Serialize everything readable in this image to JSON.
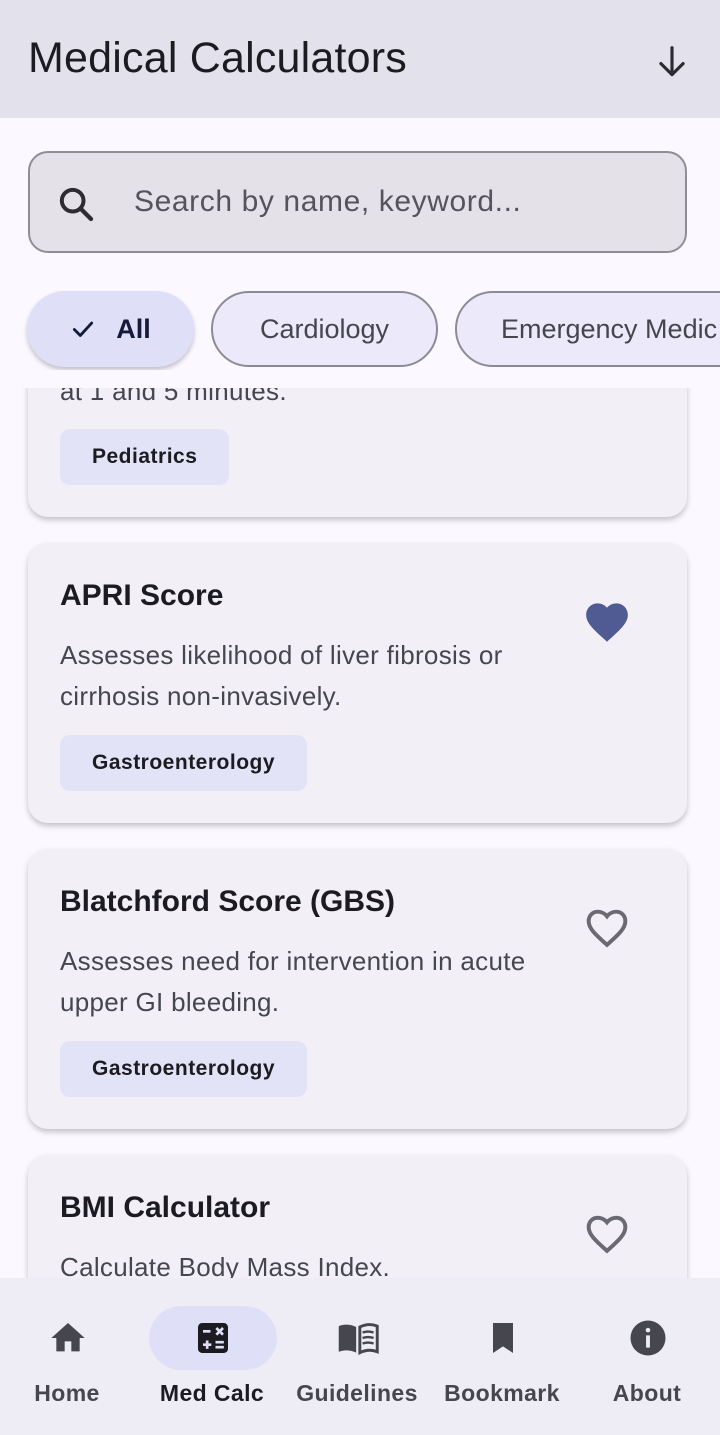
{
  "app_bar": {
    "title": "Medical Calculators",
    "action_icon": "arrow-down-icon"
  },
  "search": {
    "placeholder": "Search by name, keyword...",
    "icon": "search-icon"
  },
  "filters": [
    {
      "label": "All",
      "selected": true
    },
    {
      "label": "Cardiology",
      "selected": false
    },
    {
      "label": "Emergency Medic",
      "selected": false
    }
  ],
  "calculators": [
    {
      "title": "",
      "description": "at 1 and 5 minutes.",
      "tag": "Pediatrics",
      "favorite": null
    },
    {
      "title": "APRI Score",
      "description": "Assesses likelihood of liver fibrosis or cirrhosis non-invasively.",
      "tag": "Gastroenterology",
      "favorite": true
    },
    {
      "title": "Blatchford Score (GBS)",
      "description": "Assesses need for intervention in acute upper GI bleeding.",
      "tag": "Gastroenterology",
      "favorite": false
    },
    {
      "title": "BMI Calculator",
      "description": "Calculate Body Mass Index.",
      "tag": "",
      "favorite": false
    }
  ],
  "bottom_nav": [
    {
      "label": "Home",
      "icon": "home-icon",
      "active": false
    },
    {
      "label": "Med Calc",
      "icon": "calculator-icon",
      "active": true
    },
    {
      "label": "Guidelines",
      "icon": "book-icon",
      "active": false
    },
    {
      "label": "Bookmark",
      "icon": "bookmark-icon",
      "active": false
    },
    {
      "label": "About",
      "icon": "info-icon",
      "active": false
    }
  ],
  "colors": {
    "app_bar_bg": "#e3e1ec",
    "accent_indicator": "#dfe0f8",
    "favorite_filled": "#4f5b92",
    "favorite_outline": "#6b6a73",
    "card_bg": "#f2eff7"
  }
}
